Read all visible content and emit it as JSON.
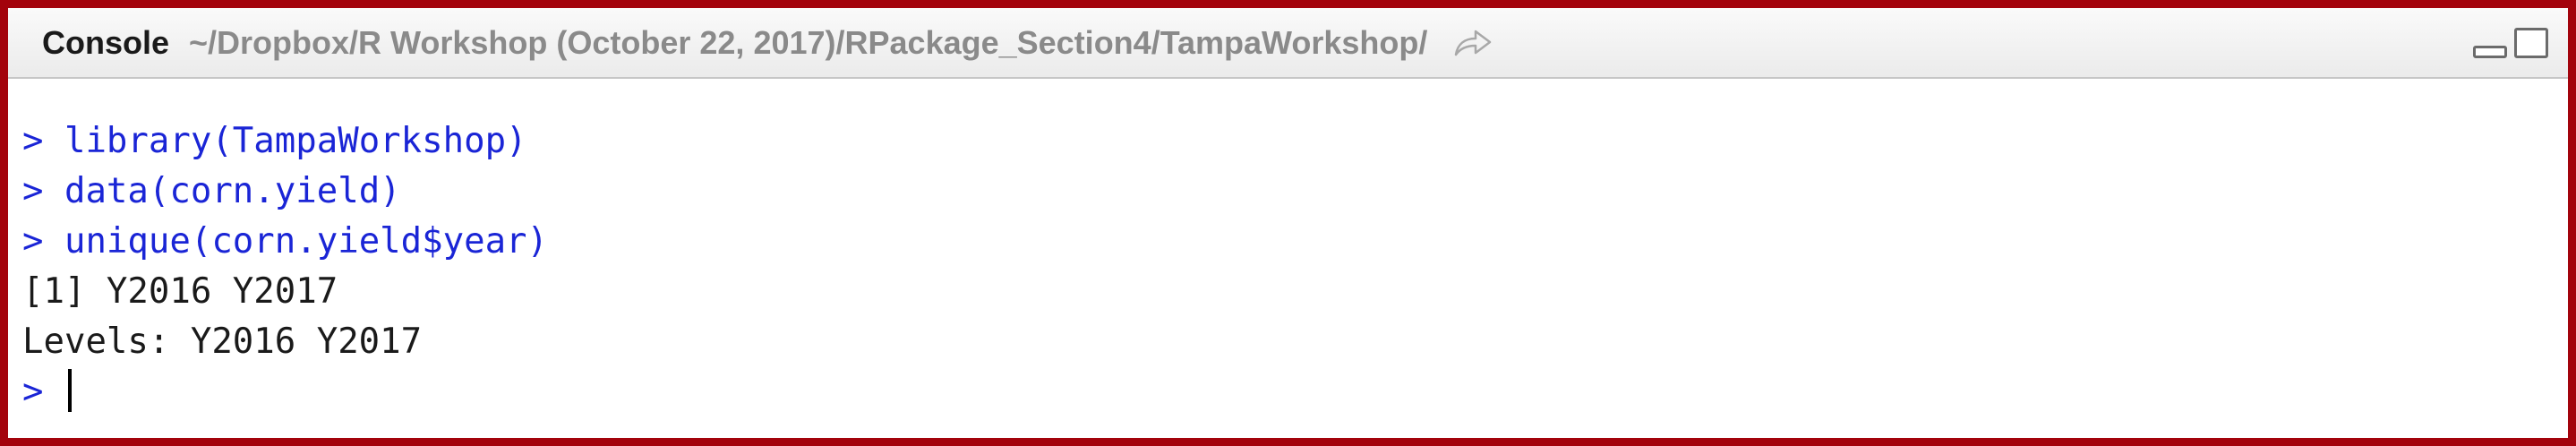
{
  "pane": {
    "title": "Console",
    "path": "~/Dropbox/R Workshop (October 22, 2017)/RPackage_Section4/TampaWorkshop/",
    "goto_icon": "arrow-share-icon",
    "window_controls": [
      "minimize-icon",
      "maximize-icon"
    ]
  },
  "console": {
    "lines": [
      {
        "type": "input",
        "prompt": ">",
        "text": "library(TampaWorkshop)"
      },
      {
        "type": "input",
        "prompt": ">",
        "text": "data(corn.yield)"
      },
      {
        "type": "input",
        "prompt": ">",
        "text": "unique(corn.yield$year)"
      },
      {
        "type": "output",
        "text": "[1] Y2016 Y2017"
      },
      {
        "type": "output",
        "text": "Levels: Y2016 Y2017"
      }
    ],
    "current_prompt": ">"
  },
  "colors": {
    "frame_border": "#a3030c",
    "command_text": "#1a25d6",
    "output_text": "#1a1a1a",
    "path_text": "#8a8a8a"
  }
}
